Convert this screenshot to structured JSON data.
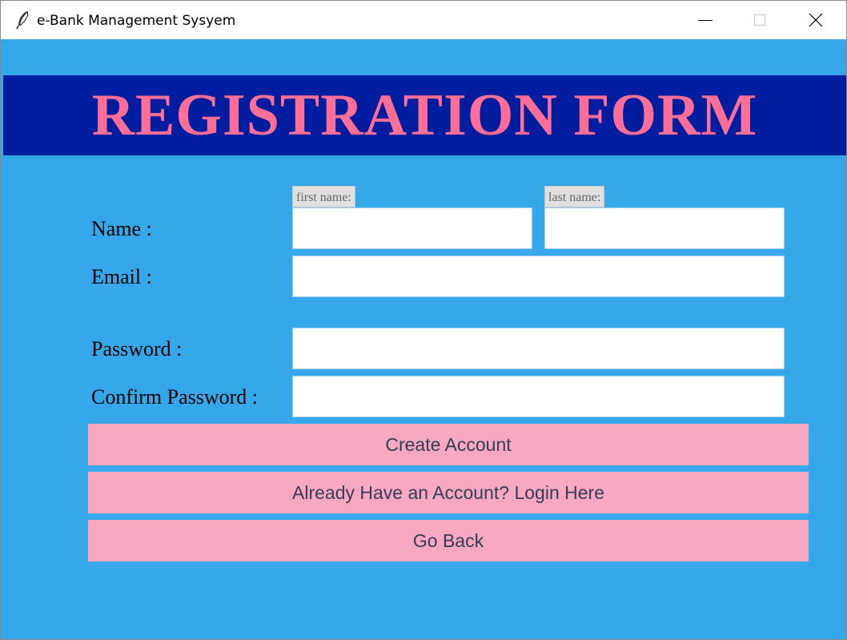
{
  "window": {
    "title": "e-Bank Management Sysyem",
    "app_icon": "feather-icon",
    "controls": [
      "minimize-icon",
      "maximize-icon",
      "close-icon"
    ]
  },
  "banner": {
    "title": "REGISTRATION FORM"
  },
  "form": {
    "name_label": "Name :",
    "first_name_hint": "first name:",
    "last_name_hint": "last name:",
    "first_name_value": "",
    "last_name_value": "",
    "email_label": "Email :",
    "email_value": "",
    "password_label": "Password :",
    "password_value": "",
    "confirm_password_label": "Confirm Password :",
    "confirm_password_value": ""
  },
  "buttons": {
    "create_account": "Create Account",
    "login_here": "Already Have an Account? Login Here",
    "go_back": "Go Back"
  },
  "colors": {
    "background": "#36a8ea",
    "banner_background": "#001d9f",
    "banner_text": "#ff6e96",
    "button_background": "#f9a8c2",
    "button_text": "#333c55",
    "hint_background": "#e0e0e0"
  }
}
